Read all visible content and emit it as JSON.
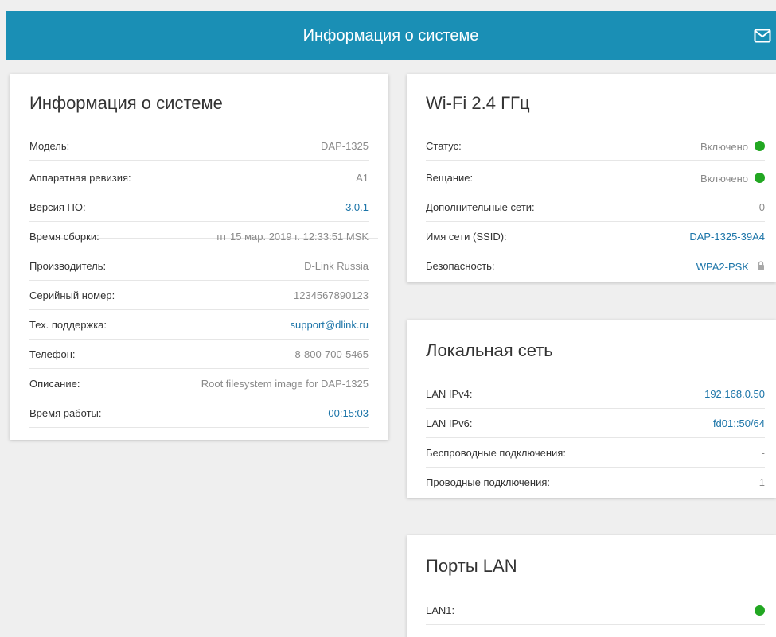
{
  "header": {
    "title": "Информация о системе"
  },
  "colors": {
    "header_bg": "#1a8fb5",
    "link": "#1b74a8",
    "status_on": "#22a722"
  },
  "system_info": {
    "title": "Информация о системе",
    "rows": [
      {
        "label": "Модель:",
        "value": "DAP-1325"
      },
      {
        "label": "Аппаратная ревизия:",
        "value": "A1"
      },
      {
        "label": "Версия ПО:",
        "value": "3.0.1"
      },
      {
        "label": "Время сборки:",
        "value": "пт 15 мар. 2019 г. 12:33:51 MSK"
      },
      {
        "label": "Производитель:",
        "value": "D-Link Russia"
      },
      {
        "label": "Серийный номер:",
        "value": "1234567890123"
      },
      {
        "label": "Тех. поддержка:",
        "value": "support@dlink.ru"
      },
      {
        "label": "Телефон:",
        "value": "8-800-700-5465"
      },
      {
        "label": "Описание:",
        "value": "Root filesystem image for DAP-1325"
      },
      {
        "label": "Время работы:",
        "value": "00:15:03"
      }
    ]
  },
  "wifi": {
    "title": "Wi-Fi 2.4 ГГц",
    "rows": [
      {
        "label": "Статус:",
        "value": "Включено"
      },
      {
        "label": "Вещание:",
        "value": "Включено"
      },
      {
        "label": "Дополнительные сети:",
        "value": "0"
      },
      {
        "label": "Имя сети (SSID):",
        "value": "DAP-1325-39A4"
      },
      {
        "label": "Безопасность:",
        "value": "WPA2-PSK"
      }
    ]
  },
  "lan": {
    "title": "Локальная сеть",
    "rows": [
      {
        "label": "LAN IPv4:",
        "value": "192.168.0.50"
      },
      {
        "label": "LAN IPv6:",
        "value": "fd01::50/64"
      },
      {
        "label": "Беспроводные подключения:",
        "value": "-"
      },
      {
        "label": "Проводные подключения:",
        "value": "1"
      }
    ]
  },
  "ports": {
    "title": "Порты LAN",
    "rows": [
      {
        "label": "LAN1:"
      }
    ]
  }
}
